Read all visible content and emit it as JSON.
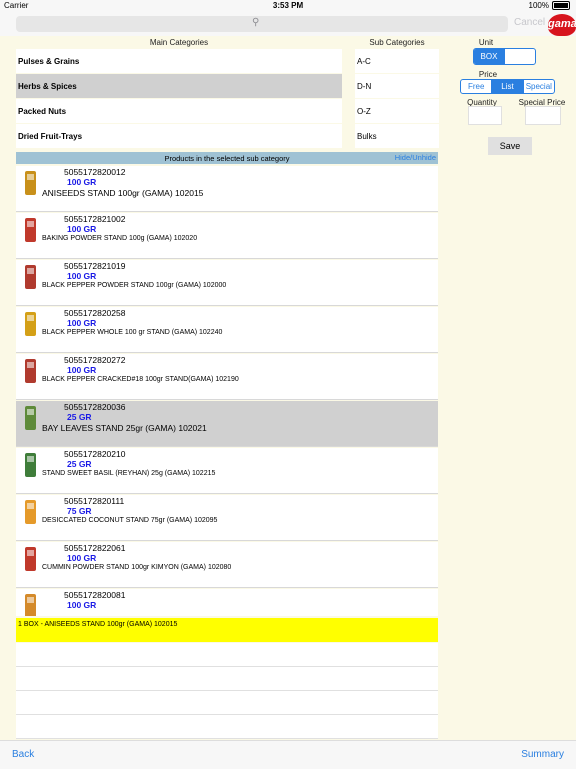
{
  "status": {
    "carrier": "Carrier",
    "time": "3:53 PM",
    "battery": "100%"
  },
  "nav": {
    "cancel": "Cancel",
    "logo_text": "gama"
  },
  "main_categories": {
    "header": "Main Categories",
    "items": [
      "Pulses & Grains",
      "Herbs & Spices",
      "Packed Nuts",
      "Dried Fruit-Trays"
    ],
    "selected_index": 1
  },
  "sub_categories": {
    "header": "Sub Categories",
    "items": [
      "A-C",
      "D-N",
      "O-Z",
      "Bulks"
    ]
  },
  "panel": {
    "unit_label": "Unit",
    "unit_options": [
      "BOX",
      ""
    ],
    "unit_selected": 0,
    "price_label": "Price",
    "price_options": [
      "Free",
      "List",
      "Special"
    ],
    "price_selected": 1,
    "quantity_label": "Quantity",
    "special_price_label": "Special Price",
    "quantity_value": "",
    "special_price_value": "",
    "save_label": "Save"
  },
  "products": {
    "header": "Products in the selected sub category",
    "hide_unhide": "Hide/Unhide",
    "rows": [
      {
        "code": "5055172820012",
        "qty": "100 GR",
        "name": "ANISEEDS  STAND 100gr (GAMA)  102015",
        "big": true,
        "color": "#c8901a",
        "selected": false
      },
      {
        "code": "5055172821002",
        "qty": "100 GR",
        "name": "BAKING POWDER STAND 100g (GAMA)  102020",
        "big": false,
        "color": "#c0392b",
        "selected": false
      },
      {
        "code": "5055172821019",
        "qty": "100 GR",
        "name": "BLACK PEPPER POWDER  STAND 100gr (GAMA)  102000",
        "big": false,
        "color": "#b03a2e",
        "selected": false
      },
      {
        "code": "5055172820258",
        "qty": "100 GR",
        "name": "BLACK PEPPER WHOLE  100 gr STAND (GAMA)  102240",
        "big": false,
        "color": "#d4a017",
        "selected": false
      },
      {
        "code": "5055172820272",
        "qty": "100 GR",
        "name": "BLACK PEPPER CRACKED#18 100gr STAND(GAMA)  102190",
        "big": false,
        "color": "#b03a2e",
        "selected": false
      },
      {
        "code": "5055172820036",
        "qty": "25 GR",
        "name": "BAY LEAVES  STAND 25gr (GAMA)  102021",
        "big": true,
        "color": "#5e8a3a",
        "selected": true
      },
      {
        "code": "5055172820210",
        "qty": "25 GR",
        "name": "STAND SWEET BASIL (REYHAN) 25g (GAMA)  102215",
        "big": false,
        "color": "#3f7d3a",
        "selected": false
      },
      {
        "code": "5055172820111",
        "qty": "75 GR",
        "name": "DESICCATED COCONUT STAND 75gr (GAMA)  102095",
        "big": false,
        "color": "#e59a2a",
        "selected": false
      },
      {
        "code": "5055172822061",
        "qty": "100 GR",
        "name": "CUMMIN POWDER STAND 100gr KIMYON (GAMA)  102080",
        "big": false,
        "color": "#c0392b",
        "selected": false
      },
      {
        "code": "5055172820081",
        "qty": "100 GR",
        "name": "",
        "big": false,
        "color": "#d48a2a",
        "selected": false
      }
    ]
  },
  "order": {
    "line": "1 BOX  - ANISEEDS  STAND 100gr (GAMA)  102015"
  },
  "bottom": {
    "back": "Back",
    "summary": "Summary"
  }
}
